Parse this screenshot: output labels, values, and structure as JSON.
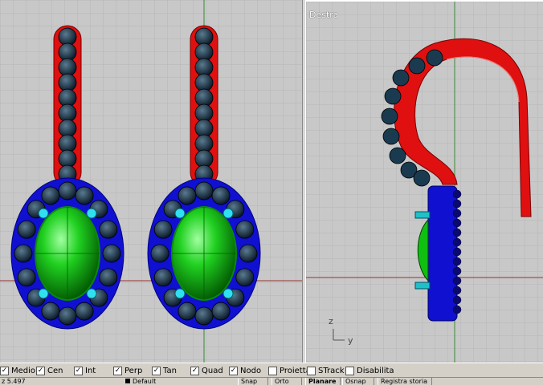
{
  "viewports": {
    "left": {
      "title": ""
    },
    "right": {
      "title": "Destra"
    }
  },
  "axis_labels": {
    "z": "z",
    "y": "y"
  },
  "colors": {
    "viewport_bg": "#c8c8c8",
    "grid": "#b6b6b6",
    "axis_red": "#9a3030",
    "axis_green": "#3a8a3a",
    "hook_red": "#e01010",
    "bezel_blue": "#1010d0",
    "stone_green": "#10c010",
    "bead_dark": "#103050"
  },
  "snaps": [
    {
      "label": "Medio",
      "checked": true
    },
    {
      "label": "Cen",
      "checked": true
    },
    {
      "label": "Int",
      "checked": true
    },
    {
      "label": "Perp",
      "checked": true
    },
    {
      "label": "Tan",
      "checked": true
    },
    {
      "label": "Quad",
      "checked": true
    },
    {
      "label": "Nodo",
      "checked": true
    },
    {
      "label": "Proietta",
      "checked": false
    },
    {
      "label": "STrack",
      "checked": false
    },
    {
      "label": "Disabilita",
      "checked": false
    }
  ],
  "status": {
    "coord": "z 5.497",
    "layer": "Default",
    "snap_btn": "Snap",
    "orto_btn": "Orto",
    "planare_btn": "Planare",
    "osnap_btn": "Osnap",
    "history_btn": "Registra storia"
  }
}
